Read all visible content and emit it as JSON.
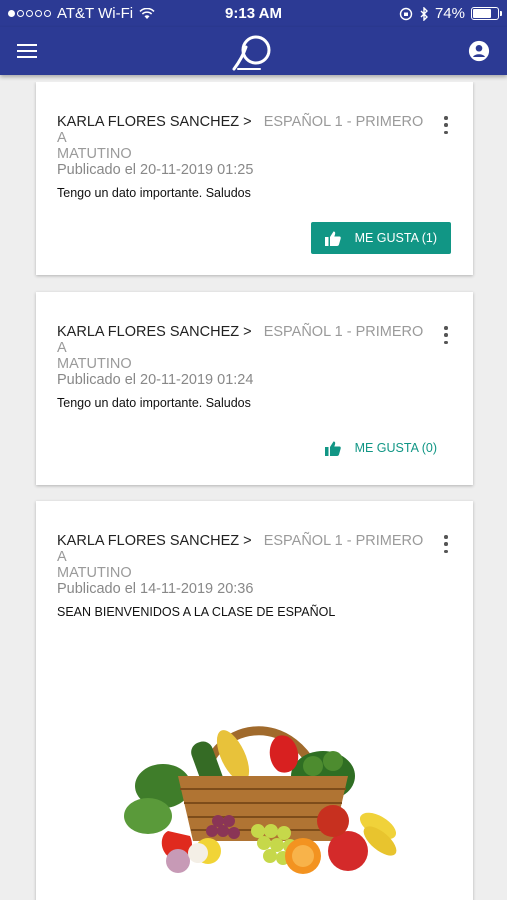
{
  "status_bar": {
    "carrier": "AT&T Wi-Fi",
    "time": "9:13 AM",
    "battery": "74%",
    "battery_level": 0.74
  },
  "app_bar": {
    "menu_icon": "menu-icon",
    "logo_icon": "app-logo",
    "account_icon": "account-icon",
    "brand_color": "#2c3a94"
  },
  "posts": [
    {
      "author": "KARLA FLORES SANCHEZ >",
      "course": "ESPAÑOL 1 - PRIMERO A",
      "shift": "MATUTINO",
      "date": "Publicado el 20-11-2019 01:25",
      "text": "Tengo un dato importante. Saludos",
      "like_label": "ME GUSTA (1)",
      "liked": true
    },
    {
      "author": "KARLA FLORES SANCHEZ >",
      "course": "ESPAÑOL 1 - PRIMERO A",
      "shift": "MATUTINO",
      "date": "Publicado el 20-11-2019 01:24",
      "text": "Tengo un dato importante. Saludos",
      "like_label": "ME GUSTA (0)",
      "liked": false
    },
    {
      "author": "KARLA FLORES SANCHEZ >",
      "course": "ESPAÑOL 1 - PRIMERO A",
      "shift": "MATUTINO",
      "date": "Publicado el 14-11-2019 20:36",
      "text": "SEAN BIENVENIDOS A LA CLASE DE ESPAÑOL",
      "image": "fruit-vegetable-basket-image"
    }
  ],
  "accent_color": "#119685"
}
